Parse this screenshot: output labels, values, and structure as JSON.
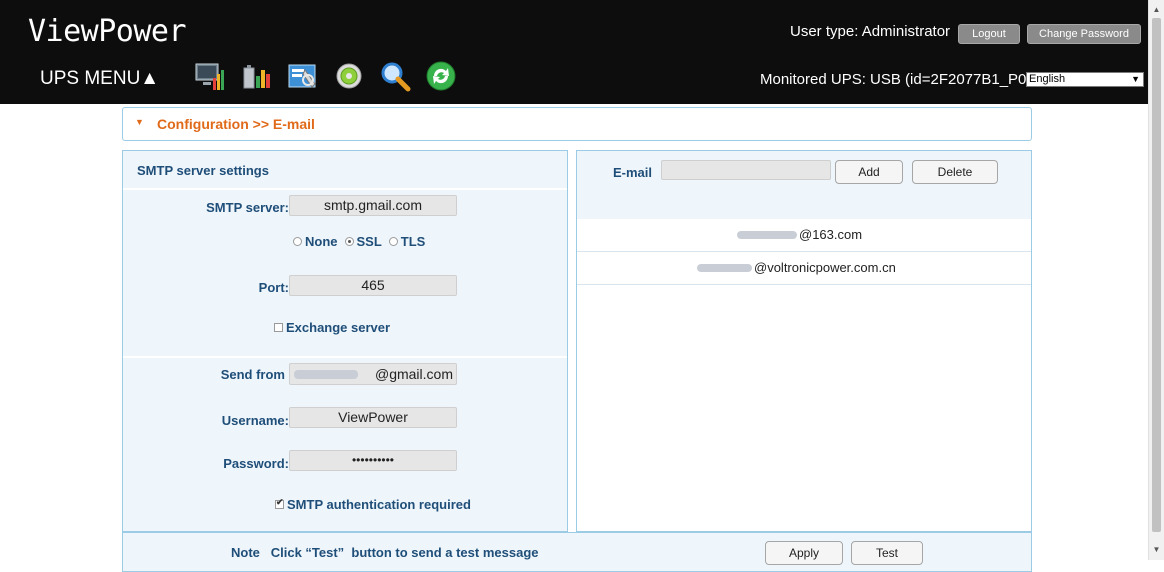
{
  "header": {
    "app_title": "ViewPower",
    "menu_label": "UPS MENU▲",
    "user_type": "User type: Administrator",
    "logout_label": "Logout",
    "change_password_label": "Change Password",
    "monitored_ups": "Monitored UPS: USB (id=2F2077B1_P01)",
    "language_selected": "English",
    "toolbar_icons": [
      "monitor-chart-icon",
      "battery-chart-icon",
      "configuration-tools-icon",
      "gear-icon",
      "search-icon",
      "refresh-icon"
    ]
  },
  "breadcrumb": "Configuration >> E-mail",
  "smtp": {
    "section_title": "SMTP server settings",
    "server_label": "SMTP server:",
    "server_value": "smtp.gmail.com",
    "security_options": [
      "None",
      "SSL",
      "TLS"
    ],
    "security_selected": "SSL",
    "port_label": "Port:",
    "port_value": "465",
    "exchange_label": "Exchange server",
    "exchange_checked": false,
    "send_from_label": "Send from",
    "send_from_domain": "@gmail.com",
    "username_label": "Username:",
    "username_value": "ViewPower",
    "password_label": "Password:",
    "password_value": "••••••••••",
    "auth_label": "SMTP authentication required",
    "auth_checked": true
  },
  "email": {
    "label": "E-mail",
    "input_value": "",
    "add_label": "Add",
    "delete_label": "Delete",
    "rows": [
      {
        "domain": "@163.com"
      },
      {
        "domain": "@voltronicpower.com.cn"
      }
    ]
  },
  "footer": {
    "note": "Note   Click “Test”  button to send a test message",
    "apply_label": "Apply",
    "test_label": "Test"
  },
  "colors": {
    "header_bg": "#0d0d0d",
    "accent_orange": "#e06a1a",
    "label_blue": "#1f4e79",
    "panel_border": "#9ccbe6",
    "panel_bg": "#eef5fb"
  }
}
